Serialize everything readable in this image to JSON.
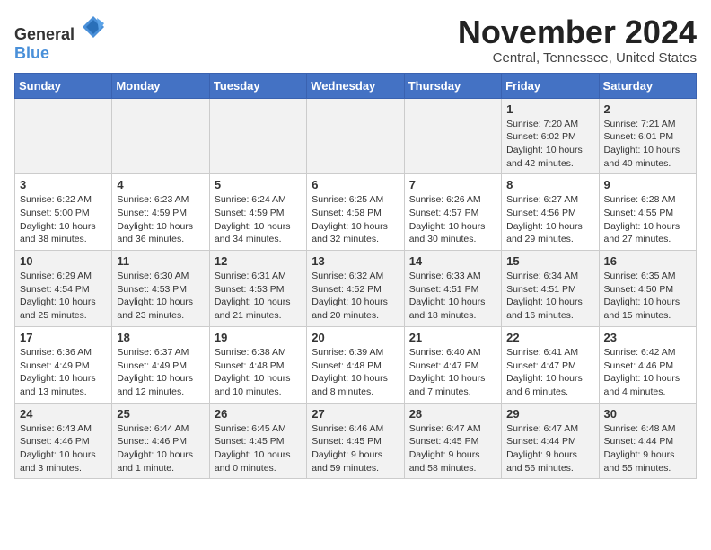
{
  "logo": {
    "general": "General",
    "blue": "Blue"
  },
  "title": "November 2024",
  "location": "Central, Tennessee, United States",
  "days_of_week": [
    "Sunday",
    "Monday",
    "Tuesday",
    "Wednesday",
    "Thursday",
    "Friday",
    "Saturday"
  ],
  "weeks": [
    [
      {
        "day": "",
        "details": ""
      },
      {
        "day": "",
        "details": ""
      },
      {
        "day": "",
        "details": ""
      },
      {
        "day": "",
        "details": ""
      },
      {
        "day": "",
        "details": ""
      },
      {
        "day": "1",
        "details": "Sunrise: 7:20 AM\nSunset: 6:02 PM\nDaylight: 10 hours and 42 minutes."
      },
      {
        "day": "2",
        "details": "Sunrise: 7:21 AM\nSunset: 6:01 PM\nDaylight: 10 hours and 40 minutes."
      }
    ],
    [
      {
        "day": "3",
        "details": "Sunrise: 6:22 AM\nSunset: 5:00 PM\nDaylight: 10 hours and 38 minutes."
      },
      {
        "day": "4",
        "details": "Sunrise: 6:23 AM\nSunset: 4:59 PM\nDaylight: 10 hours and 36 minutes."
      },
      {
        "day": "5",
        "details": "Sunrise: 6:24 AM\nSunset: 4:59 PM\nDaylight: 10 hours and 34 minutes."
      },
      {
        "day": "6",
        "details": "Sunrise: 6:25 AM\nSunset: 4:58 PM\nDaylight: 10 hours and 32 minutes."
      },
      {
        "day": "7",
        "details": "Sunrise: 6:26 AM\nSunset: 4:57 PM\nDaylight: 10 hours and 30 minutes."
      },
      {
        "day": "8",
        "details": "Sunrise: 6:27 AM\nSunset: 4:56 PM\nDaylight: 10 hours and 29 minutes."
      },
      {
        "day": "9",
        "details": "Sunrise: 6:28 AM\nSunset: 4:55 PM\nDaylight: 10 hours and 27 minutes."
      }
    ],
    [
      {
        "day": "10",
        "details": "Sunrise: 6:29 AM\nSunset: 4:54 PM\nDaylight: 10 hours and 25 minutes."
      },
      {
        "day": "11",
        "details": "Sunrise: 6:30 AM\nSunset: 4:53 PM\nDaylight: 10 hours and 23 minutes."
      },
      {
        "day": "12",
        "details": "Sunrise: 6:31 AM\nSunset: 4:53 PM\nDaylight: 10 hours and 21 minutes."
      },
      {
        "day": "13",
        "details": "Sunrise: 6:32 AM\nSunset: 4:52 PM\nDaylight: 10 hours and 20 minutes."
      },
      {
        "day": "14",
        "details": "Sunrise: 6:33 AM\nSunset: 4:51 PM\nDaylight: 10 hours and 18 minutes."
      },
      {
        "day": "15",
        "details": "Sunrise: 6:34 AM\nSunset: 4:51 PM\nDaylight: 10 hours and 16 minutes."
      },
      {
        "day": "16",
        "details": "Sunrise: 6:35 AM\nSunset: 4:50 PM\nDaylight: 10 hours and 15 minutes."
      }
    ],
    [
      {
        "day": "17",
        "details": "Sunrise: 6:36 AM\nSunset: 4:49 PM\nDaylight: 10 hours and 13 minutes."
      },
      {
        "day": "18",
        "details": "Sunrise: 6:37 AM\nSunset: 4:49 PM\nDaylight: 10 hours and 12 minutes."
      },
      {
        "day": "19",
        "details": "Sunrise: 6:38 AM\nSunset: 4:48 PM\nDaylight: 10 hours and 10 minutes."
      },
      {
        "day": "20",
        "details": "Sunrise: 6:39 AM\nSunset: 4:48 PM\nDaylight: 10 hours and 8 minutes."
      },
      {
        "day": "21",
        "details": "Sunrise: 6:40 AM\nSunset: 4:47 PM\nDaylight: 10 hours and 7 minutes."
      },
      {
        "day": "22",
        "details": "Sunrise: 6:41 AM\nSunset: 4:47 PM\nDaylight: 10 hours and 6 minutes."
      },
      {
        "day": "23",
        "details": "Sunrise: 6:42 AM\nSunset: 4:46 PM\nDaylight: 10 hours and 4 minutes."
      }
    ],
    [
      {
        "day": "24",
        "details": "Sunrise: 6:43 AM\nSunset: 4:46 PM\nDaylight: 10 hours and 3 minutes."
      },
      {
        "day": "25",
        "details": "Sunrise: 6:44 AM\nSunset: 4:46 PM\nDaylight: 10 hours and 1 minute."
      },
      {
        "day": "26",
        "details": "Sunrise: 6:45 AM\nSunset: 4:45 PM\nDaylight: 10 hours and 0 minutes."
      },
      {
        "day": "27",
        "details": "Sunrise: 6:46 AM\nSunset: 4:45 PM\nDaylight: 9 hours and 59 minutes."
      },
      {
        "day": "28",
        "details": "Sunrise: 6:47 AM\nSunset: 4:45 PM\nDaylight: 9 hours and 58 minutes."
      },
      {
        "day": "29",
        "details": "Sunrise: 6:47 AM\nSunset: 4:44 PM\nDaylight: 9 hours and 56 minutes."
      },
      {
        "day": "30",
        "details": "Sunrise: 6:48 AM\nSunset: 4:44 PM\nDaylight: 9 hours and 55 minutes."
      }
    ]
  ]
}
